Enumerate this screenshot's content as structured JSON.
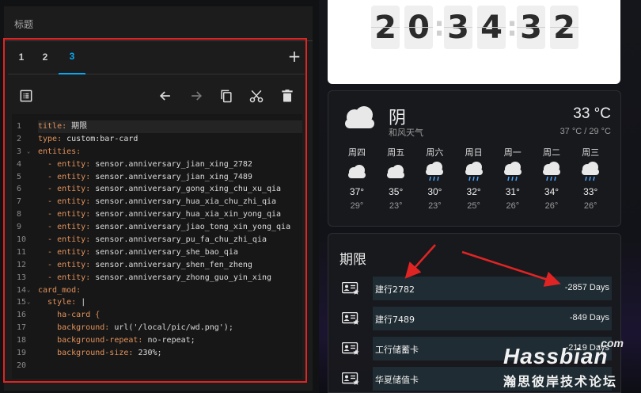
{
  "editor": {
    "title": "标题",
    "tabs": [
      "1",
      "2",
      "3"
    ],
    "active_tab": "3",
    "add_tab": "+",
    "line_numbers": [
      "1",
      "2",
      "3",
      "4",
      "5",
      "6",
      "7",
      "8",
      "9",
      "10",
      "11",
      "12",
      "13",
      "14",
      "15",
      "16",
      "17",
      "18",
      "19",
      "20"
    ],
    "code_lines": [
      {
        "key": "title:",
        "val": " 期限"
      },
      {
        "key": "type:",
        "val": " custom:bar-card"
      },
      {
        "key": "entities:",
        "val": ""
      },
      {
        "key": "  - entity:",
        "val": " sensor.anniversary_jian_xing_2782"
      },
      {
        "key": "  - entity:",
        "val": " sensor.anniversary_jian_xing_7489"
      },
      {
        "key": "  - entity:",
        "val": " sensor.anniversary_gong_xing_chu_xu_qia"
      },
      {
        "key": "  - entity:",
        "val": " sensor.anniversary_hua_xia_chu_zhi_qia"
      },
      {
        "key": "  - entity:",
        "val": " sensor.anniversary_hua_xia_xin_yong_qia"
      },
      {
        "key": "  - entity:",
        "val": " sensor.anniversary_jiao_tong_xin_yong_qia"
      },
      {
        "key": "  - entity:",
        "val": " sensor.anniversary_pu_fa_chu_zhi_qia"
      },
      {
        "key": "  - entity:",
        "val": " sensor.anniversary_she_bao_qia"
      },
      {
        "key": "  - entity:",
        "val": " sensor.anniversary_shen_fen_zheng"
      },
      {
        "key": "  - entity:",
        "val": " sensor.anniversary_zhong_guo_yin_xing"
      },
      {
        "key": "card_mod:",
        "val": ""
      },
      {
        "key": "  style:",
        "val": " |"
      },
      {
        "key": "    ha-card {",
        "val": ""
      },
      {
        "key": "    background:",
        "val": " url('/local/pic/wd.png');"
      },
      {
        "key": "    background-repeat:",
        "val": " no-repeat;"
      },
      {
        "key": "    background-size:",
        "val": " 230%;"
      },
      {
        "key": "",
        "val": ""
      }
    ]
  },
  "clock": {
    "digits": [
      "2",
      "0",
      "3",
      "4",
      "3",
      "2"
    ],
    "separator": ":"
  },
  "weather": {
    "condition": "阴",
    "wind": "和风天气",
    "temperature": "33 °C",
    "range": "37 °C / 29 °C",
    "forecast": [
      {
        "day": "周四",
        "hi": "37°",
        "lo": "29°",
        "icon": "cloud-icon"
      },
      {
        "day": "周五",
        "hi": "35°",
        "lo": "23°",
        "icon": "cloud-icon"
      },
      {
        "day": "周六",
        "hi": "30°",
        "lo": "23°",
        "icon": "rain-cloud-icon"
      },
      {
        "day": "周日",
        "hi": "32°",
        "lo": "25°",
        "icon": "rain-cloud-icon"
      },
      {
        "day": "周一",
        "hi": "31°",
        "lo": "26°",
        "icon": "rain-cloud-icon"
      },
      {
        "day": "周二",
        "hi": "34°",
        "lo": "26°",
        "icon": "rain-cloud-icon"
      },
      {
        "day": "周三",
        "hi": "33°",
        "lo": "26°",
        "icon": "rain-cloud-icon"
      }
    ]
  },
  "bar_card": {
    "title": "期限",
    "rows": [
      {
        "label": "建行2782",
        "value": "-2857 Days"
      },
      {
        "label": "建行7489",
        "value": "-849 Days"
      },
      {
        "label": "工行储蓄卡",
        "value": "-2119 Days"
      },
      {
        "label": "华夏储值卡",
        "value": ""
      }
    ]
  },
  "watermark": {
    "com": ".com",
    "main": "Hassbian",
    "sub": "瀚思彼岸技术论坛"
  },
  "colors": {
    "accent": "#03a9f4",
    "highlight_border": "#e02424",
    "code_key": "#e3925b"
  }
}
